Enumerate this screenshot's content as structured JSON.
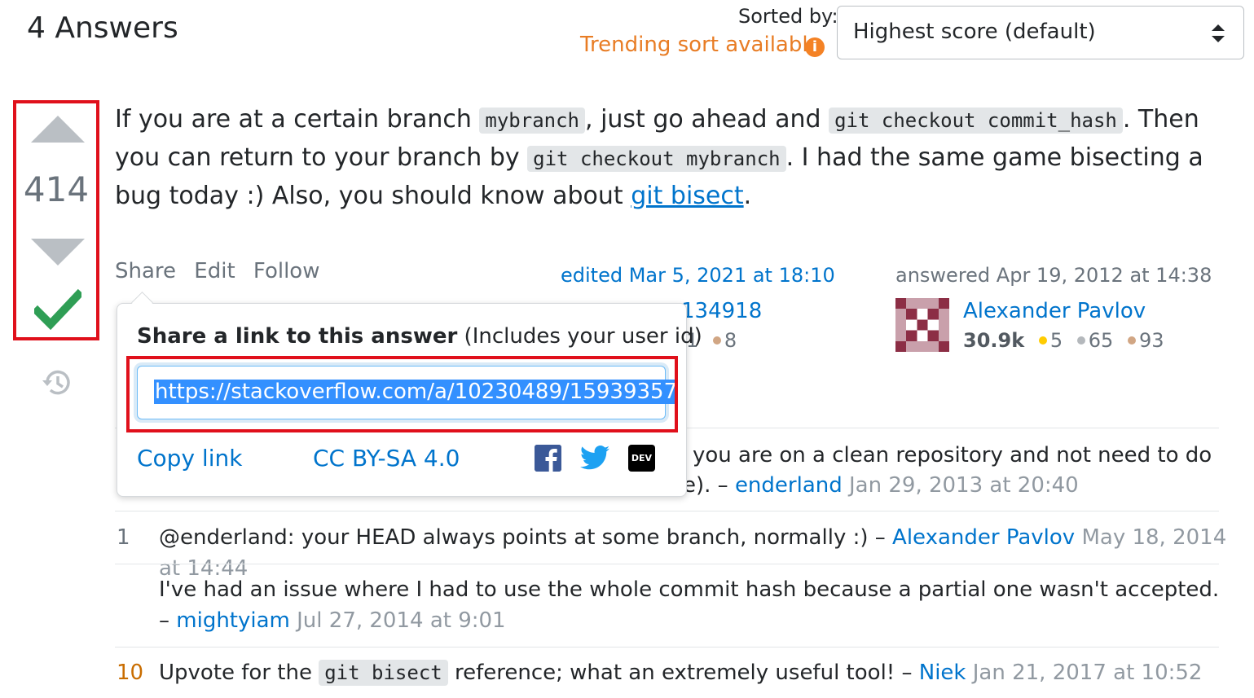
{
  "header": {
    "answers_title": "4 Answers",
    "sorted_by_label": "Sorted by:",
    "trending_label": "Trending sort available",
    "info_icon": "i",
    "sort_value": "Highest score (default)"
  },
  "vote": {
    "count": "414",
    "accepted": true
  },
  "answer": {
    "p1": "If you are at a certain branch ",
    "c1": "mybranch",
    "p2": ", just go ahead and ",
    "c2": "git checkout commit_hash",
    "p3": ". Then you can return to your branch by ",
    "c3": "git checkout mybranch",
    "p4": ". I had the same game bisecting a bug today :) Also, you should know about ",
    "link": "git bisect",
    "p5": "."
  },
  "post_menu": {
    "share": "Share",
    "edit": "Edit",
    "follow": "Follow"
  },
  "edited": "edited Mar 5, 2021 at 18:10",
  "editor": {
    "id_partial": "134918",
    "badges_partial": "1",
    "bronze": "8"
  },
  "answered": "answered Apr 19, 2012 at 14:38",
  "author": {
    "name": "Alexander Pavlov",
    "rep": "30.9k",
    "gold": "5",
    "silver": "65",
    "bronze": "93"
  },
  "share_popover": {
    "heading_bold": "Share a link to this answer",
    "heading_rest": " (Includes your user id)",
    "url": "https://stackoverflow.com/a/10230489/15939357",
    "copy_link": "Copy link",
    "license": "CC BY-SA 4.0",
    "dev_label": "DEV"
  },
  "comments": [
    {
      "score": "",
      "line1": "you are on a clean repository and not need to do",
      "line2_prefix": "e). – ",
      "user": "enderland",
      "date": "Jan 29, 2013 at 20:40"
    },
    {
      "score": "1",
      "text": "@enderland: your HEAD always points at some branch, normally :) – ",
      "user": "Alexander Pavlov",
      "date": "May 18, 2014 at 14:44"
    },
    {
      "score": "",
      "text": "I've had an issue where I had to use the whole commit hash because a partial one wasn't accepted.",
      "line2_prefix": "– ",
      "user": "mightyiam",
      "date": "Jul 27, 2014 at 9:01"
    },
    {
      "score": "10",
      "text_before": "Upvote for the ",
      "code": "git bisect",
      "text_after": " reference; what an extremely useful tool! – ",
      "user": "Niek",
      "date": "Jan 21, 2017 at 10:52"
    }
  ],
  "colors": {
    "accent": "#0074cc",
    "trending": "#e87c24",
    "accepted": "#2f9e55",
    "highlight_box": "#e0101b"
  }
}
